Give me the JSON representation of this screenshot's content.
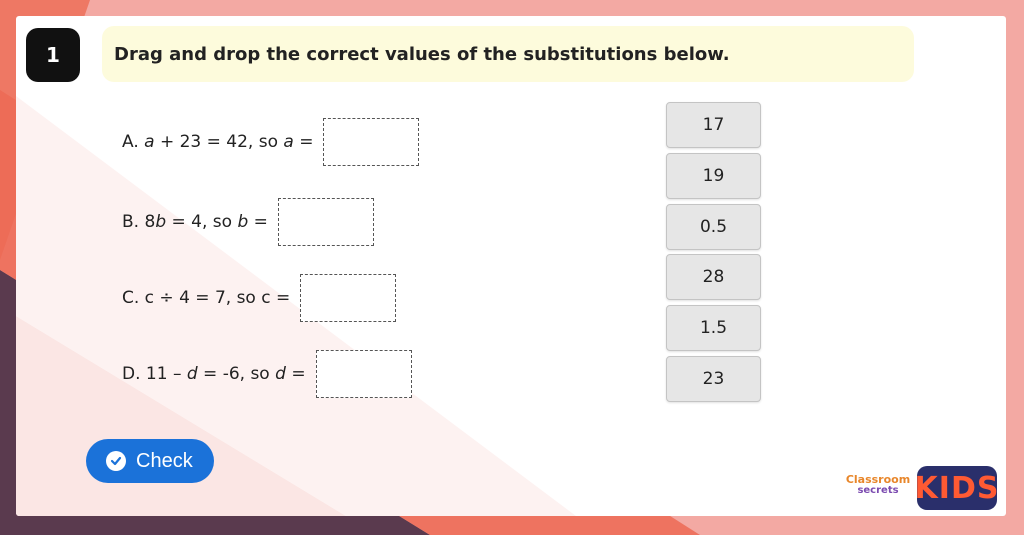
{
  "question_number": "1",
  "instruction": "Drag and drop the correct values of the substitutions below.",
  "questions": [
    {
      "label": "A.",
      "parts": [
        {
          "t": " "
        },
        {
          "t": "a",
          "v": true
        },
        {
          "t": " + 23 = 42, so "
        },
        {
          "t": "a",
          "v": true
        },
        {
          "t": " ="
        }
      ]
    },
    {
      "label": "B.",
      "parts": [
        {
          "t": " 8"
        },
        {
          "t": "b",
          "v": true
        },
        {
          "t": " = 4, so "
        },
        {
          "t": "b",
          "v": true
        },
        {
          "t": " ="
        }
      ]
    },
    {
      "label": "C.",
      "parts": [
        {
          "t": " c ÷ 4 = 7, so c ="
        }
      ]
    },
    {
      "label": "D.",
      "parts": [
        {
          "t": " 11 – "
        },
        {
          "t": "d",
          "v": true
        },
        {
          "t": " = -6, so "
        },
        {
          "t": "d",
          "v": true
        },
        {
          "t": " ="
        }
      ]
    }
  ],
  "answer_tiles": [
    "17",
    "19",
    "0.5",
    "28",
    "1.5",
    "23"
  ],
  "check_button": {
    "label": "Check",
    "color": "#1b72d9"
  },
  "logo": {
    "line1": "Classroom",
    "line2": "secrets",
    "kids": "KIDS"
  },
  "colors": {
    "background": "#f3a9a3",
    "accent_dark": "#5a3a4e",
    "accent_coral": "#ec6a55",
    "instruction_bg": "#fdfbdc"
  }
}
